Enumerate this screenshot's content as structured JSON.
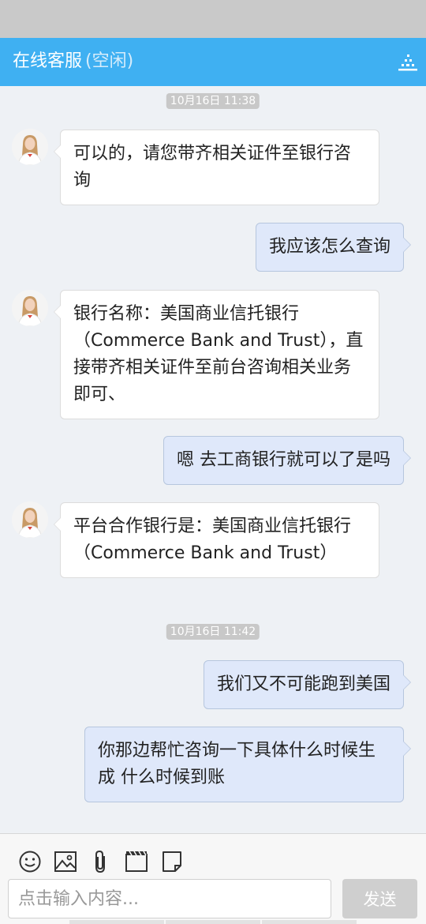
{
  "header": {
    "title": "在线客服",
    "status": "(空闲)",
    "menu_icon": "list-menu-icon"
  },
  "colors": {
    "header_bg": "#3fb0f2",
    "chat_bg": "#eef1f5",
    "agent_bubble": "#ffffff",
    "user_bubble": "#dfe8fa",
    "timestamp_bg": "#c8c8c8",
    "send_button": "#cfcfcf"
  },
  "chat": {
    "timestamps": [
      "10月16日 11:38",
      "10月16日 11:42"
    ],
    "messages": [
      {
        "from": "agent",
        "text": "可以的，请您带齐相关证件至银行咨询"
      },
      {
        "from": "user",
        "text": "我应该怎么查询"
      },
      {
        "from": "agent",
        "text": "银行名称：美国商业信托银行（Commerce Bank and Trust），直接带齐相关证件至前台咨询相关业务即可、"
      },
      {
        "from": "user",
        "text": "嗯 去工商银行就可以了是吗"
      },
      {
        "from": "agent",
        "text": "平台合作银行是：美国商业信托银行（Commerce Bank and Trust）"
      },
      {
        "from": "user",
        "text": "我们又不可能跑到美国"
      },
      {
        "from": "user",
        "text": "你那边帮忙咨询一下具体什么时候生成 什么时候到账"
      }
    ]
  },
  "toolbar": {
    "icons": [
      "emoji-icon",
      "image-icon",
      "attachment-icon",
      "video-icon",
      "note-icon"
    ]
  },
  "composer": {
    "placeholder": "点击输入内容...",
    "send_label": "发送"
  }
}
